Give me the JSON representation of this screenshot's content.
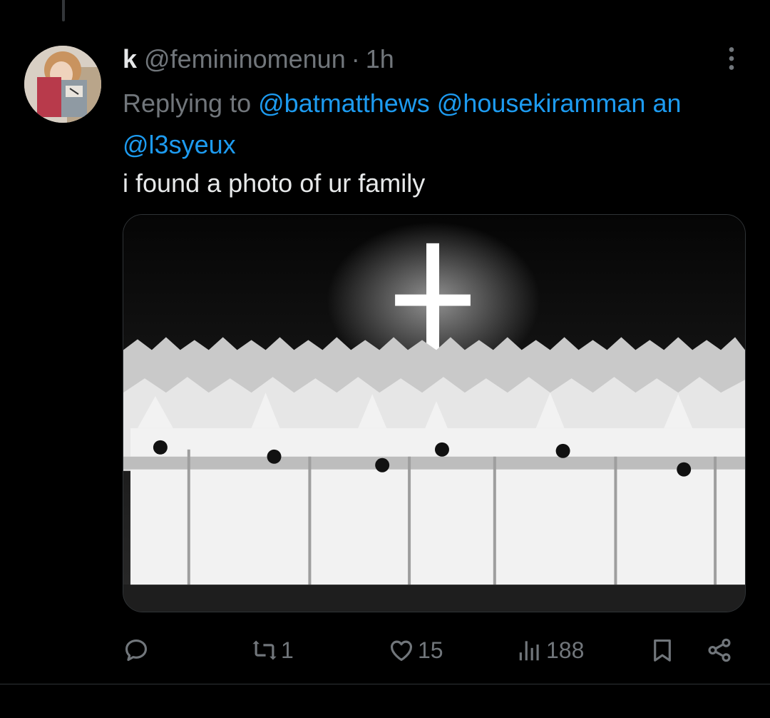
{
  "tweet": {
    "display_name": "k",
    "handle": "@femininomenun",
    "separator": "·",
    "time": "1h",
    "reply_prefix": "Replying to",
    "reply_mentions_line1": [
      "@batmatthews",
      "@housekiramman",
      "an"
    ],
    "reply_mentions_line2": "@l3syeux",
    "text": "i found a photo of ur family"
  },
  "actions": {
    "reply_icon": "reply-bubble-icon",
    "retweet_icon": "retweet-icon",
    "retweet_count": "1",
    "like_icon": "heart-icon",
    "like_count": "15",
    "views_icon": "bar-chart-icon",
    "views_count": "188",
    "bookmark_icon": "bookmark-icon",
    "share_icon": "share-icon"
  },
  "colors": {
    "background": "#000000",
    "primary_text": "#e7e9ea",
    "secondary_text": "#71767b",
    "link": "#1d9bf0"
  }
}
